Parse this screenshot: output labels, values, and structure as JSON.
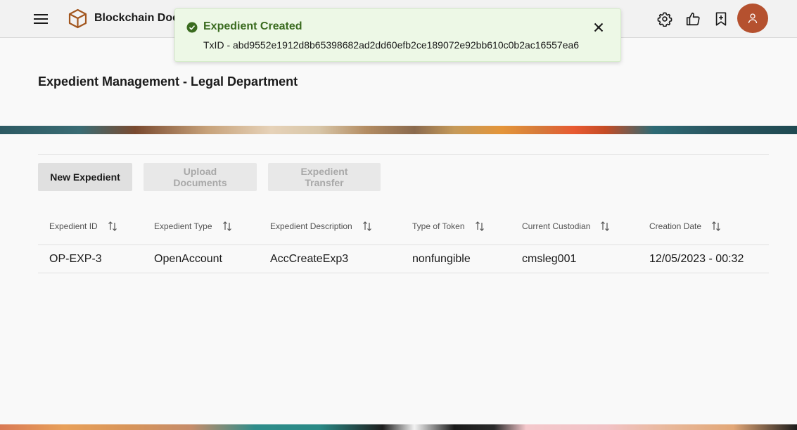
{
  "header": {
    "app_title": "Blockchain Doc",
    "icons": [
      "menu-icon",
      "cube-logo-icon",
      "settings-icon",
      "thumbs-up-icon",
      "bookmark-add-icon",
      "user-avatar-icon"
    ]
  },
  "toast": {
    "title": "Expedient Created",
    "message": "TxID - abd9552e1912d8b65398682ad2dd60efb2ce189072e92bb610c0b2ac16557ea6",
    "status_color": "#3a6b1f",
    "close_icon": "close-icon"
  },
  "page": {
    "title": "Expedient Management - Legal Department"
  },
  "toolbar": {
    "new_label": "New Expedient",
    "upload_label": "Upload Documents",
    "transfer_label": "Expedient Transfer"
  },
  "table": {
    "columns": [
      "Expedient ID",
      "Expedient Type",
      "Expedient Description",
      "Type of Token",
      "Current Custodian",
      "Creation Date"
    ],
    "rows": [
      [
        "OP-EXP-3",
        "OpenAccount",
        "AccCreateExp3",
        "nonfungible",
        "cmsleg001",
        "12/05/2023 - 00:32"
      ]
    ]
  },
  "colors": {
    "avatar": "#b5512f",
    "logo": "#a2561e",
    "toast_bg": "#edf8e6"
  }
}
